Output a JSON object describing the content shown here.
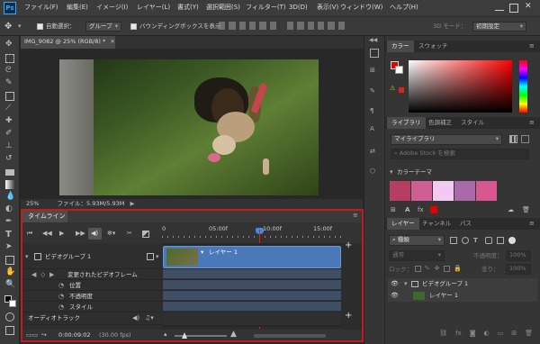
{
  "menubar": {
    "logo": "Ps",
    "items": [
      "ファイル(F)",
      "編集(E)",
      "イメージ(I)",
      "レイヤー(L)",
      "書式(Y)",
      "選択範囲(S)",
      "フィルター(T)",
      "3D(D)",
      "表示(V)",
      "ウィンドウ(W)",
      "ヘルプ(H)"
    ]
  },
  "options": {
    "auto_select_label": "自動選択：",
    "auto_select_value": "グループ",
    "bbox_label": "バウンディングボックスを表示",
    "mode_label": "3D モード：",
    "workspace": "初期設定"
  },
  "document": {
    "tab_title": "IMG_9082 @ 25% (RGB/8) *",
    "zoom": "25%",
    "file_info": "ファイル：5.93M/5.93M"
  },
  "timeline": {
    "tab": "タイムライン",
    "ruler_ticks": [
      "0",
      "05:00f",
      "10:00f",
      "15:00f"
    ],
    "tracks": {
      "video_group": "ビデオグループ 1",
      "changed_frames": "変更されたビデオフレーム",
      "position": "位置",
      "opacity": "不透明度",
      "style": "スタイル",
      "audio": "オーディオトラック"
    },
    "clip_name": "レイヤー 1",
    "timecode": "0:00:09:02",
    "fps": "(30.00 fps)"
  },
  "color_panel": {
    "tabs": [
      "カラー",
      "スウォッチ"
    ],
    "foreground": "#e00000",
    "background": "#ffffff"
  },
  "library_panel": {
    "tabs": [
      "ライブラリ",
      "色調補正",
      "スタイル"
    ],
    "library_name": "マイライブラリ",
    "search_placeholder": "Adobe Stock を検索",
    "theme_title": "カラーテーマ",
    "theme_colors": [
      "#b73e63",
      "#cf5f92",
      "#f1c9f3",
      "#a86aa8",
      "#d8578e"
    ]
  },
  "layers_panel": {
    "tabs": [
      "レイヤー",
      "チャンネル",
      "パス"
    ],
    "filter_value": "種類",
    "blend_mode": "通常",
    "opacity_label": "不透明度：",
    "opacity_value": "100%",
    "lock_label": "ロック：",
    "fill_label": "塗り：",
    "fill_value": "100%",
    "group_name": "ビデオグループ 1",
    "layer_name": "レイヤー 1"
  }
}
